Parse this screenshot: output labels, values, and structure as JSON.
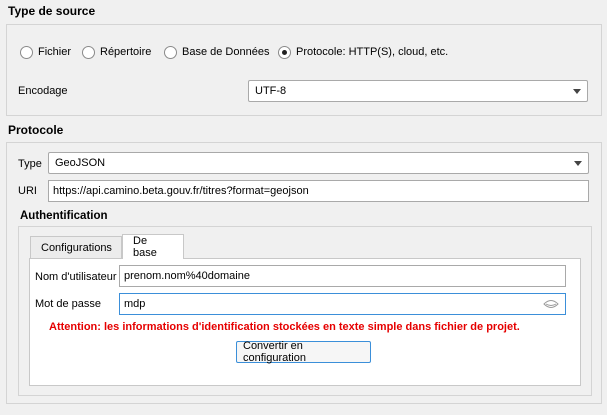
{
  "source_type": {
    "title": "Type de source",
    "options": [
      {
        "label": "Fichier",
        "checked": false
      },
      {
        "label": "Répertoire",
        "checked": false
      },
      {
        "label": "Base de Données",
        "checked": false
      },
      {
        "label": "Protocole: HTTP(S), cloud, etc.",
        "checked": true
      }
    ],
    "encoding_label": "Encodage",
    "encoding_value": "UTF-8"
  },
  "protocol": {
    "title": "Protocole",
    "type_label": "Type",
    "type_value": "GeoJSON",
    "uri_label": "URI",
    "uri_value": "https://api.camino.beta.gouv.fr/titres?format=geojson"
  },
  "auth": {
    "title": "Authentification",
    "tabs": [
      {
        "label": "Configurations",
        "active": false
      },
      {
        "label": "De base",
        "active": true
      }
    ],
    "username_label": "Nom d'utilisateur",
    "username_value": "prenom.nom%40domaine",
    "password_label": "Mot de passe",
    "password_value": "mdp",
    "warning": "Attention: les informations d'identification stockées en texte simple dans fichier de projet.",
    "convert_button": "Convertir en configuration"
  },
  "colors": {
    "warning": "#e60000",
    "focus": "#3b8fd9"
  }
}
